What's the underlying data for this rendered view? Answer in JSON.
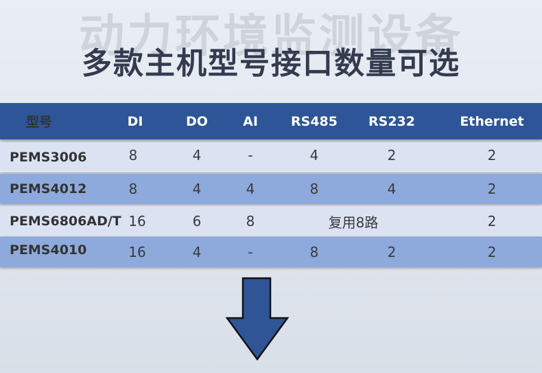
{
  "background_title": "动力环境监测设备",
  "main_title": "多款主机型号接口数量可选",
  "table": {
    "headers": [
      "型号",
      "DI",
      "DO",
      "AI",
      "RS485",
      "RS232",
      "Ethernet"
    ],
    "rows": [
      {
        "model": "PEMS3006",
        "di": "8",
        "do": "4",
        "ai": "-",
        "rs485": "4",
        "rs232": "2",
        "ethernet": "2"
      },
      {
        "model": "PEMS4012",
        "di": "8",
        "do": "4",
        "ai": "4",
        "rs485": "8",
        "rs232": "4",
        "ethernet": "2"
      },
      {
        "model": "PEMS6806AD/T",
        "di": "16",
        "do": "6",
        "ai": "8",
        "rs485_rs232_merged": "复用8路",
        "ethernet": "2"
      },
      {
        "model": "PEMS4010",
        "di": "16",
        "do": "4",
        "ai": "-",
        "rs485": "8",
        "rs232": "2",
        "ethernet": "2"
      }
    ]
  },
  "colors": {
    "header_bg": "#2d5597",
    "row_light": "#dbe3f3",
    "row_dark": "#8eaadc",
    "arrow_fill": "#2f5597"
  },
  "icons": {
    "arrow": "arrow-down-icon"
  }
}
